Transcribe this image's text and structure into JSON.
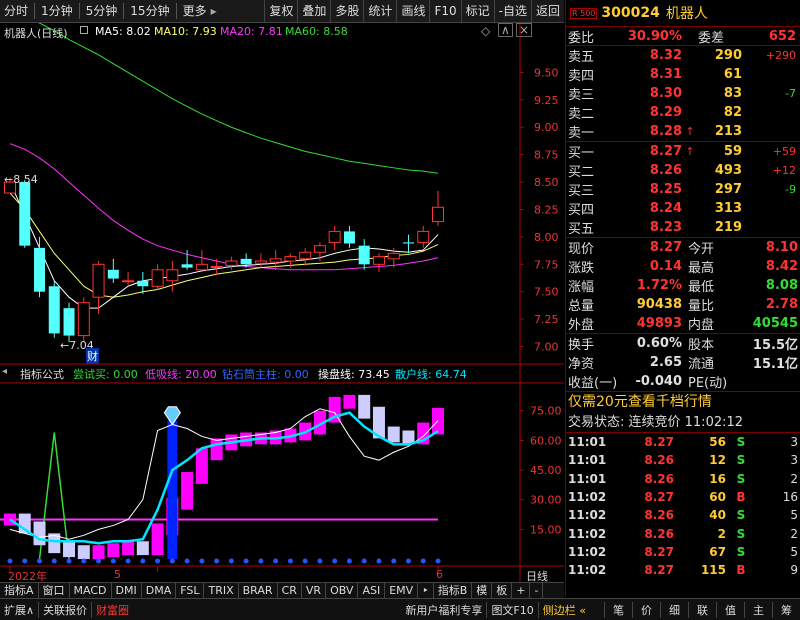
{
  "toolbar": {
    "tabs": [
      "分时",
      "1分钟",
      "5分钟",
      "15分钟",
      "更多"
    ],
    "tools": [
      "复权",
      "叠加",
      "多股",
      "统计",
      "画线",
      "F10",
      "标记",
      "-自选",
      "返回"
    ],
    "more_arrow": "▸"
  },
  "chart_header": {
    "title": "机器人(日线)",
    "ma5": "MA5: 8.02",
    "ma10": "MA10: 7.93",
    "ma20": "MA20: 7.81",
    "ma60": "MA60: 8.58",
    "colors": {
      "ma5": "#ffffff",
      "ma10": "#ffff66",
      "ma20": "#ff33ff",
      "ma60": "#33dd33"
    }
  },
  "price_axis": [
    "9.50",
    "9.25",
    "9.00",
    "8.75",
    "8.50",
    "8.25",
    "8.00",
    "7.75",
    "7.50",
    "7.25",
    "7.00"
  ],
  "annotations": {
    "high": "8.54",
    "low": "7.04",
    "cai": "财"
  },
  "indicator_header": {
    "title": "指标公式",
    "l1": "尝试买: 0.00",
    "l2": "低吸线: 20.00",
    "l3": "钻石筒主柱: 0.00",
    "l4": "操盘线: 73.45",
    "l5": "散户线: 64.74"
  },
  "ind_axis": [
    "75.00",
    "60.00",
    "45.00",
    "30.00",
    "15.00"
  ],
  "date_axis": {
    "year": "2022年",
    "m5": "5",
    "m6": "6",
    "label": "日线"
  },
  "chart_data": [
    {
      "type": "candlestick",
      "x": [
        1,
        2,
        3,
        4,
        5,
        6,
        7,
        8,
        9,
        10,
        11,
        12,
        13,
        14,
        15,
        16,
        17,
        18,
        19,
        20,
        21,
        22,
        23,
        24,
        25,
        26,
        27,
        28,
        29,
        30
      ],
      "ohlc": [
        [
          8.4,
          8.54,
          8.45,
          8.5
        ],
        [
          8.5,
          8.52,
          7.9,
          7.92
        ],
        [
          7.9,
          8.0,
          7.45,
          7.5
        ],
        [
          7.55,
          7.6,
          7.08,
          7.12
        ],
        [
          7.35,
          7.4,
          7.04,
          7.1
        ],
        [
          7.1,
          7.45,
          7.05,
          7.4
        ],
        [
          7.45,
          7.78,
          7.3,
          7.75
        ],
        [
          7.7,
          7.8,
          7.58,
          7.62
        ],
        [
          7.6,
          7.68,
          7.55,
          7.6
        ],
        [
          7.6,
          7.68,
          7.48,
          7.55
        ],
        [
          7.55,
          7.75,
          7.52,
          7.7
        ],
        [
          7.6,
          7.78,
          7.5,
          7.7
        ],
        [
          7.75,
          7.88,
          7.7,
          7.72
        ],
        [
          7.7,
          7.88,
          7.68,
          7.75
        ],
        [
          7.73,
          7.8,
          7.65,
          7.73
        ],
        [
          7.74,
          7.82,
          7.7,
          7.78
        ],
        [
          7.8,
          7.85,
          7.72,
          7.75
        ],
        [
          7.76,
          7.85,
          7.72,
          7.78
        ],
        [
          7.77,
          7.88,
          7.7,
          7.8
        ],
        [
          7.78,
          7.85,
          7.72,
          7.82
        ],
        [
          7.8,
          7.9,
          7.74,
          7.86
        ],
        [
          7.86,
          7.95,
          7.78,
          7.92
        ],
        [
          7.95,
          8.1,
          7.88,
          8.05
        ],
        [
          8.05,
          8.1,
          7.9,
          7.94
        ],
        [
          7.92,
          7.98,
          7.7,
          7.75
        ],
        [
          7.75,
          7.85,
          7.68,
          7.82
        ],
        [
          7.8,
          7.9,
          7.72,
          7.85
        ],
        [
          7.95,
          8.02,
          7.85,
          7.94
        ],
        [
          7.95,
          8.1,
          7.9,
          8.05
        ],
        [
          8.14,
          8.42,
          8.1,
          8.27
        ]
      ],
      "ma5": [
        8.5,
        8.2,
        7.9,
        7.6,
        7.45,
        7.35,
        7.35,
        7.45,
        7.55,
        7.6,
        7.62,
        7.64,
        7.66,
        7.69,
        7.71,
        7.73,
        7.74,
        7.75,
        7.76,
        7.78,
        7.79,
        7.81,
        7.85,
        7.88,
        7.9,
        7.89,
        7.87,
        7.86,
        7.88,
        8.02
      ],
      "ma10": [
        8.4,
        8.25,
        8.05,
        7.85,
        7.7,
        7.55,
        7.47,
        7.45,
        7.47,
        7.5,
        7.52,
        7.56,
        7.6,
        7.63,
        7.66,
        7.68,
        7.7,
        7.72,
        7.73,
        7.74,
        7.75,
        7.76,
        7.77,
        7.79,
        7.8,
        7.81,
        7.83,
        7.84,
        7.87,
        7.93
      ],
      "ma20": [
        8.85,
        8.8,
        8.72,
        8.62,
        8.5,
        8.38,
        8.26,
        8.15,
        8.06,
        7.98,
        7.92,
        7.88,
        7.84,
        7.81,
        7.78,
        7.75,
        7.73,
        7.72,
        7.71,
        7.7,
        7.7,
        7.7,
        7.7,
        7.71,
        7.72,
        7.73,
        7.74,
        7.76,
        7.78,
        7.81
      ],
      "ma60": [
        10.1,
        10.02,
        9.95,
        9.88,
        9.8,
        9.73,
        9.66,
        9.58,
        9.5,
        9.42,
        9.34,
        9.26,
        9.19,
        9.12,
        9.06,
        9.0,
        8.95,
        8.9,
        8.86,
        8.82,
        8.78,
        8.75,
        8.72,
        8.69,
        8.67,
        8.65,
        8.63,
        8.61,
        8.6,
        8.58
      ],
      "ylim": [
        6.85,
        9.75
      ]
    },
    {
      "type": "bar",
      "x": [
        1,
        2,
        3,
        4,
        5,
        6,
        7,
        8,
        9,
        10,
        11,
        12,
        13,
        14,
        15,
        16,
        17,
        18,
        19,
        20,
        21,
        22,
        23,
        24,
        25,
        26,
        27,
        28,
        29,
        30
      ],
      "series": [
        {
          "name": "操盘线",
          "values": [
            20,
            16,
            10,
            6,
            4,
            3,
            4,
            5,
            6,
            5,
            15,
            28,
            41,
            53,
            58,
            60,
            61,
            61,
            62,
            63,
            66,
            72,
            79,
            80,
            74,
            64,
            62,
            61,
            66,
            73.45
          ]
        },
        {
          "name": "散户线",
          "values": [
            20,
            15,
            10,
            9,
            9,
            9,
            8,
            9,
            9,
            10,
            25,
            45,
            50,
            56,
            58,
            59,
            60,
            61,
            61,
            62,
            64,
            68,
            72,
            74,
            67,
            62,
            58,
            58,
            60,
            64.74
          ]
        },
        {
          "name": "白线",
          "values": [
            15,
            13,
            11,
            12,
            10,
            12,
            15,
            17,
            20,
            30,
            65,
            68,
            66,
            62,
            60,
            61,
            62,
            63,
            64,
            66,
            72,
            76,
            74,
            62,
            52,
            50,
            54,
            57,
            62,
            70
          ]
        }
      ],
      "low_line": 20,
      "green_spike": [
        4,
        64
      ],
      "blue_bar": [
        11,
        70
      ],
      "ylim": [
        -3,
        88
      ]
    }
  ],
  "quote": {
    "r500": "R 500",
    "code": "300024",
    "name": "机器人",
    "webi_label": "委比",
    "webi": "30.90%",
    "weicha_label": "委差",
    "weicha": "652",
    "asks": [
      {
        "label": "卖五",
        "price": "8.32",
        "arrow": "",
        "vol": "290",
        "chg": "+290",
        "chgc": "red"
      },
      {
        "label": "卖四",
        "price": "8.31",
        "arrow": "",
        "vol": "61",
        "chg": "",
        "chgc": "red"
      },
      {
        "label": "卖三",
        "price": "8.30",
        "arrow": "",
        "vol": "83",
        "chg": "-7",
        "chgc": "grn"
      },
      {
        "label": "卖二",
        "price": "8.29",
        "arrow": "",
        "vol": "82",
        "chg": "",
        "chgc": "red"
      },
      {
        "label": "卖一",
        "price": "8.28",
        "arrow": "↑",
        "vol": "213",
        "chg": "",
        "chgc": "red"
      }
    ],
    "bids": [
      {
        "label": "买一",
        "price": "8.27",
        "arrow": "↑",
        "vol": "59",
        "chg": "+59",
        "chgc": "red"
      },
      {
        "label": "买二",
        "price": "8.26",
        "arrow": "",
        "vol": "493",
        "chg": "+12",
        "chgc": "red"
      },
      {
        "label": "买三",
        "price": "8.25",
        "arrow": "",
        "vol": "297",
        "chg": "-9",
        "chgc": "grn"
      },
      {
        "label": "买四",
        "price": "8.24",
        "arrow": "",
        "vol": "313",
        "chg": "",
        "chgc": "red"
      },
      {
        "label": "买五",
        "price": "8.23",
        "arrow": "",
        "vol": "219",
        "chg": "",
        "chgc": "red"
      }
    ],
    "stats1": [
      [
        "现价",
        "8.27",
        "red",
        "今开",
        "8.10",
        "red"
      ],
      [
        "涨跌",
        "0.14",
        "red",
        "最高",
        "8.42",
        "red"
      ],
      [
        "涨幅",
        "1.72%",
        "red",
        "最低",
        "8.08",
        "grn"
      ],
      [
        "总量",
        "90438",
        "yel",
        "量比",
        "2.78",
        "red"
      ],
      [
        "外盘",
        "49893",
        "red",
        "内盘",
        "40545",
        "grn"
      ]
    ],
    "stats2": [
      [
        "换手",
        "0.60%",
        "wht",
        "股本",
        "15.5亿",
        "wht"
      ],
      [
        "净资",
        "2.65",
        "wht",
        "流通",
        "15.1亿",
        "wht"
      ],
      [
        "收益(一)",
        "-0.040",
        "wht",
        "PE(动)",
        "",
        "wht"
      ]
    ],
    "ad": "仅需20元查看千档行情",
    "status": "交易状态: 连续竞价 11:02:12",
    "ticks": [
      [
        "11:01",
        "8.27",
        "56",
        "S",
        "3"
      ],
      [
        "11:01",
        "8.26",
        "12",
        "S",
        "3"
      ],
      [
        "11:01",
        "8.26",
        "16",
        "S",
        "2"
      ],
      [
        "11:02",
        "8.27",
        "60",
        "B",
        "16"
      ],
      [
        "11:02",
        "8.26",
        "40",
        "S",
        "5"
      ],
      [
        "11:02",
        "8.26",
        "2",
        "S",
        "2"
      ],
      [
        "11:02",
        "8.27",
        "67",
        "S",
        "5"
      ],
      [
        "11:02",
        "8.27",
        "115",
        "B",
        "9"
      ]
    ]
  },
  "bottom_tabs": [
    "指标A",
    "窗口",
    "MACD",
    "DMI",
    "DMA",
    "FSL",
    "TRIX",
    "BRAR",
    "CR",
    "VR",
    "OBV",
    "ASI",
    "EMV",
    "‣",
    "指标B",
    "模",
    "板",
    "+",
    "-"
  ],
  "status_bar": {
    "left": [
      "扩展∧",
      "关联报价",
      "财富圈"
    ],
    "center": [
      "新用户福利专享",
      "图文F10",
      "侧边栏 «"
    ],
    "right": [
      "笔",
      "价",
      "细",
      "联",
      "值",
      "主",
      "筹"
    ]
  }
}
